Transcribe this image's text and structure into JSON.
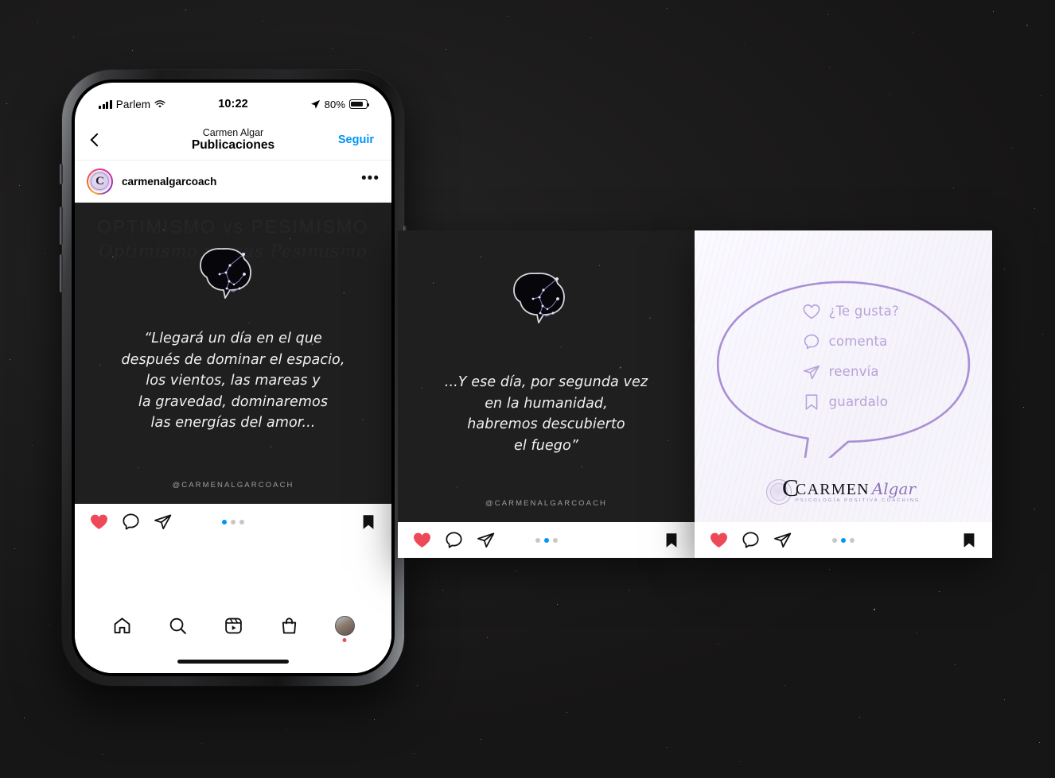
{
  "status_bar": {
    "carrier": "Parlem",
    "time": "10:22",
    "battery_percent": "80%",
    "signal_icon": "signal-bars-icon",
    "wifi_icon": "wifi-icon",
    "location_icon": "location-arrow-icon",
    "battery_icon": "battery-icon"
  },
  "nav": {
    "back_icon": "back-chevron-icon",
    "subtitle": "Carmen Algar",
    "title": "Publicaciones",
    "follow_label": "Seguir",
    "follow_color": "#0095f6"
  },
  "post_header": {
    "username": "carmenalgarcoach",
    "avatar_letter": "C",
    "more_label": "•••"
  },
  "cards": [
    {
      "id": "card-1",
      "ghost_title": "OPTIMISMO vs PESIMISMO",
      "ghost_subtitle": "Optimismo versus Pesimismo",
      "quote": "“Llegará un día en el que\ndespués de dominar el espacio,\nlos vientos, las mareas y\nla gravedad, dominaremos\nlas energías del amor...",
      "handle": "@CARMENALGARCOACH",
      "active_dot": 0
    },
    {
      "id": "card-2",
      "quote": "...Y ese día, por segunda vez\nen la humanidad,\nhabremos descubierto\nel fuego”",
      "handle": "@CARMENALGARCOACH",
      "active_dot": 1
    },
    {
      "id": "card-3",
      "cta": [
        {
          "icon": "heart-outline-icon",
          "label": "¿Te gusta?"
        },
        {
          "icon": "comment-outline-icon",
          "label": "comenta"
        },
        {
          "icon": "share-outline-icon",
          "label": "reenvía"
        },
        {
          "icon": "bookmark-outline-icon",
          "label": "guardalo"
        }
      ],
      "logo": {
        "initial": "C",
        "name": "CARMEN",
        "script": "Algar",
        "tagline": "PSICOLOGÍA POSITIVA COACHING"
      },
      "active_dot": 1
    }
  ],
  "actions": {
    "like_icon": "heart-filled-icon",
    "comment_icon": "comment-icon",
    "share_icon": "share-icon",
    "save_icon": "bookmark-filled-icon",
    "like_color": "#ed4956",
    "dot_active_color": "#0095f6",
    "dot_count": 3
  },
  "tab_bar": {
    "items": [
      {
        "icon": "home-icon",
        "name": "tab-home"
      },
      {
        "icon": "search-icon",
        "name": "tab-search"
      },
      {
        "icon": "reels-icon",
        "name": "tab-reels"
      },
      {
        "icon": "shop-icon",
        "name": "tab-shop"
      },
      {
        "icon": "profile-avatar-icon",
        "name": "tab-profile"
      }
    ]
  },
  "theme": {
    "background": "#201f1f",
    "card_dark": "#201f1f",
    "accent_purple": "#b7a3da"
  }
}
